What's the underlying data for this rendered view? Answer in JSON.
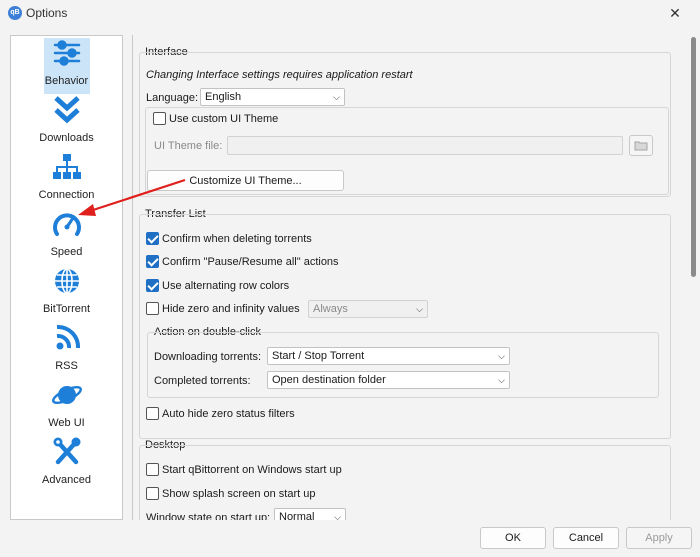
{
  "window": {
    "title": "Options",
    "app_icon_text": "qB",
    "close_glyph": "✕"
  },
  "sidebar": {
    "items": [
      {
        "label": "Behavior",
        "icon": "sliders-icon",
        "selected": true
      },
      {
        "label": "Downloads",
        "icon": "double-chevron-down-icon",
        "selected": false
      },
      {
        "label": "Connection",
        "icon": "network-icon",
        "selected": false
      },
      {
        "label": "Speed",
        "icon": "speedometer-icon",
        "selected": false
      },
      {
        "label": "BitTorrent",
        "icon": "globe-icon",
        "selected": false
      },
      {
        "label": "RSS",
        "icon": "rss-icon",
        "selected": false
      },
      {
        "label": "Web UI",
        "icon": "planet-icon",
        "selected": false
      },
      {
        "label": "Advanced",
        "icon": "tools-icon",
        "selected": false
      }
    ]
  },
  "interface": {
    "title": "Interface",
    "note": "Changing Interface settings requires application restart",
    "language_label": "Language:",
    "language_value": "English",
    "custom_theme_label": "Use custom UI Theme",
    "custom_theme_checked": false,
    "theme_file_label": "UI Theme file:",
    "theme_file_value": "",
    "customize_button": "Customize UI Theme..."
  },
  "transfer_list": {
    "title": "Transfer List",
    "confirm_delete": {
      "label": "Confirm when deleting torrents",
      "checked": true
    },
    "confirm_pause": {
      "label": "Confirm \"Pause/Resume all\" actions",
      "checked": true
    },
    "alt_row_colors": {
      "label": "Use alternating row colors",
      "checked": true
    },
    "hide_zero": {
      "label": "Hide zero and infinity values",
      "checked": false,
      "combo_value": "Always"
    },
    "double_click": {
      "title": "Action on double-click",
      "downloading_label": "Downloading torrents:",
      "downloading_value": "Start / Stop Torrent",
      "completed_label": "Completed torrents:",
      "completed_value": "Open destination folder"
    },
    "auto_hide": {
      "label": "Auto hide zero status filters",
      "checked": false
    }
  },
  "desktop": {
    "title": "Desktop",
    "start_on_windows": {
      "label": "Start qBittorrent on Windows start up",
      "checked": false
    },
    "splash_screen": {
      "label": "Show splash screen on start up",
      "checked": false
    },
    "window_state_label": "Window state on start up:",
    "window_state_value": "Normal"
  },
  "footer": {
    "ok": "OK",
    "cancel": "Cancel",
    "apply": "Apply"
  },
  "colors": {
    "accent": "#1f6fc5",
    "icon_blue": "#1e7fd8",
    "annotation_arrow": "#e0201c",
    "selected_bg": "#cce4f7"
  }
}
